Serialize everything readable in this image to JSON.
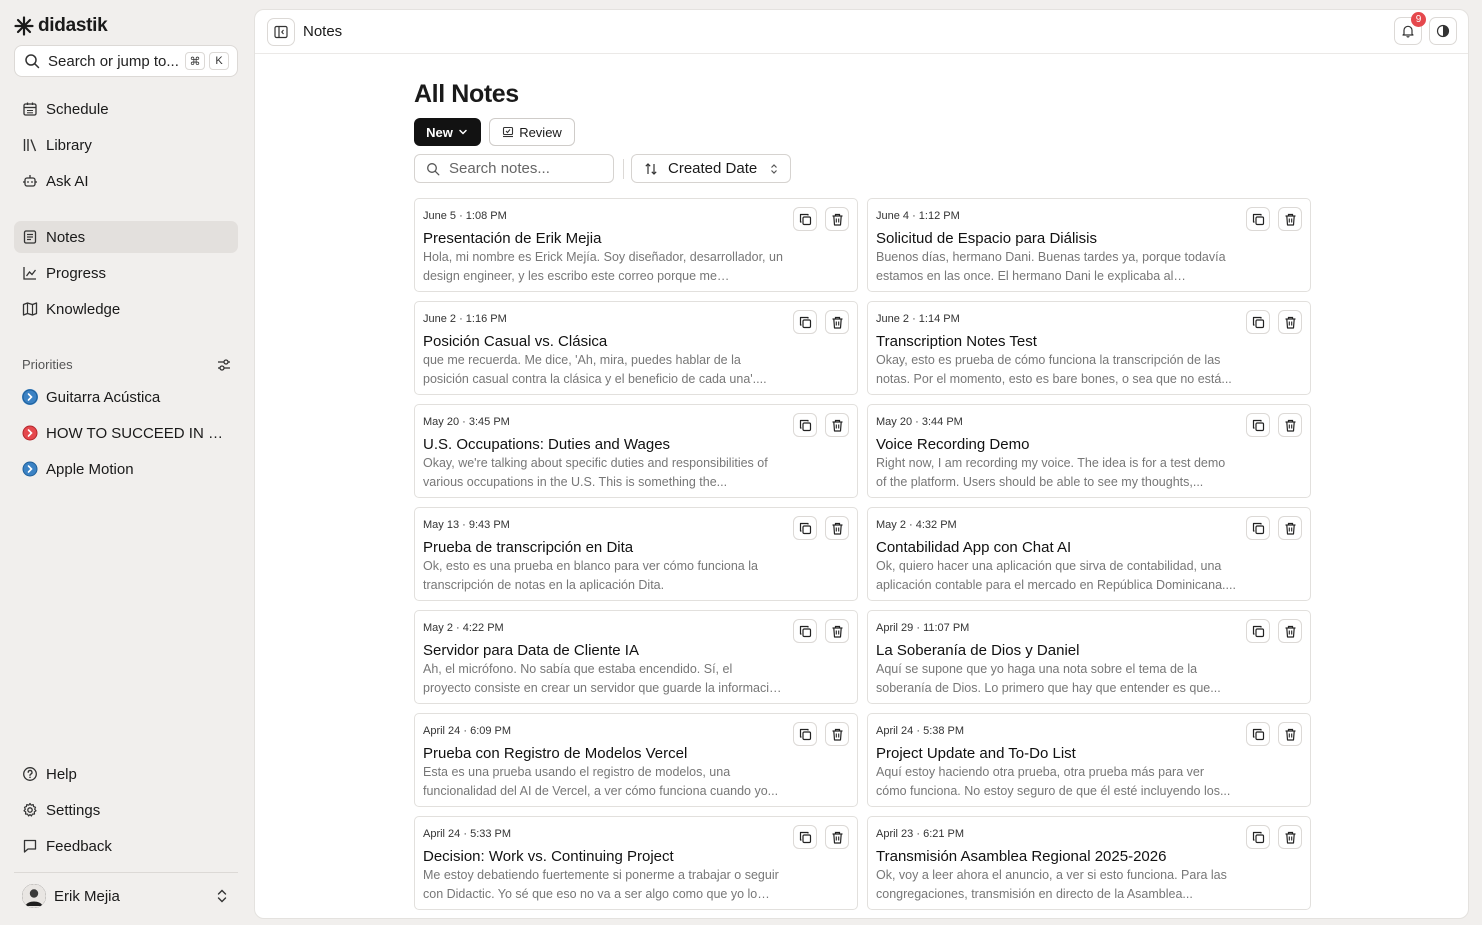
{
  "brand": {
    "name": "didastik"
  },
  "sidebar": {
    "search_placeholder": "Search or jump to...",
    "shortcut_keys": [
      "⌘",
      "K"
    ],
    "nav_top": [
      {
        "label": "Schedule",
        "icon": "calendar-icon"
      },
      {
        "label": "Library",
        "icon": "library-icon"
      },
      {
        "label": "Ask AI",
        "icon": "bot-icon"
      }
    ],
    "nav_main": [
      {
        "label": "Notes",
        "icon": "notes-icon",
        "active": true
      },
      {
        "label": "Progress",
        "icon": "chart-icon"
      },
      {
        "label": "Knowledge",
        "icon": "map-icon"
      }
    ],
    "priorities_label": "Priorities",
    "priorities": [
      {
        "label": "Guitarra Acústica",
        "color": "#3b82c4"
      },
      {
        "label": "HOW TO SUCCEED IN MRBEAST PRODUCTION",
        "color": "#e5484d"
      },
      {
        "label": "Apple Motion",
        "color": "#3b82c4"
      }
    ],
    "nav_bottom": [
      {
        "label": "Help",
        "icon": "help-icon"
      },
      {
        "label": "Settings",
        "icon": "gear-icon"
      },
      {
        "label": "Feedback",
        "icon": "feedback-icon"
      }
    ],
    "user": {
      "name": "Erik Mejia"
    }
  },
  "topbar": {
    "title": "Notes",
    "notification_count": "9"
  },
  "page": {
    "title": "All Notes",
    "new_label": "New",
    "review_label": "Review",
    "search_placeholder": "Search notes...",
    "sort_label": "Created Date"
  },
  "notes": [
    {
      "date": "June 5 · 1:08 PM",
      "title": "Presentación de Erik Mejia",
      "preview": "Hola, mi nombre es Erick Mejía. Soy diseñador, desarrollador, un design engineer, y les escribo este correo porque me interesaría..."
    },
    {
      "date": "June 4 · 1:12 PM",
      "title": "Solicitud de Espacio para Diálisis",
      "preview": "Buenos días, hermano Dani. Buenas tardes ya, porque todavía estamos en las once. El hermano Dani le explicaba al hermano..."
    },
    {
      "date": "June 2 · 1:16 PM",
      "title": "Posición Casual vs. Clásica",
      "preview": "que me recuerda. Me dice, 'Ah, mira, puedes hablar de la posición casual contra la clásica y el beneficio de cada una'...."
    },
    {
      "date": "June 2 · 1:14 PM",
      "title": "Transcription Notes Test",
      "preview": "Okay, esto es prueba de cómo funciona la transcripción de las notas. Por el momento, esto es bare bones, o sea que no está..."
    },
    {
      "date": "May 20 · 3:45 PM",
      "title": "U.S. Occupations: Duties and Wages",
      "preview": "Okay, we're talking about specific duties and responsibilities of various occupations in the U.S. This is something the..."
    },
    {
      "date": "May 20 · 3:44 PM",
      "title": "Voice Recording Demo",
      "preview": "Right now, I am recording my voice. The idea is for a test demo of the platform. Users should be able to see my thoughts,..."
    },
    {
      "date": "May 13 · 9:43 PM",
      "title": "Prueba de transcripción en Dita",
      "preview": "Ok, esto es una prueba en blanco para ver cómo funciona la transcripción de notas en la aplicación Dita."
    },
    {
      "date": "May 2 · 4:32 PM",
      "title": "Contabilidad App con Chat AI",
      "preview": "Ok, quiero hacer una aplicación que sirva de contabilidad, una aplicación contable para el mercado en República Dominicana...."
    },
    {
      "date": "May 2 · 4:22 PM",
      "title": "Servidor para Data de Cliente IA",
      "preview": "Ah, el micrófono. No sabía que estaba encendido. Sí, el proyecto consiste en crear un servidor que guarde la información del..."
    },
    {
      "date": "April 29 · 11:07 PM",
      "title": "La Soberanía de Dios y Daniel",
      "preview": "Aquí se supone que yo haga una nota sobre el tema de la soberanía de Dios. Lo primero que hay que entender es que..."
    },
    {
      "date": "April 24 · 6:09 PM",
      "title": "Prueba con Registro de Modelos Vercel",
      "preview": "Esta es una prueba usando el registro de modelos, una funcionalidad del AI de Vercel, a ver cómo funciona cuando yo..."
    },
    {
      "date": "April 24 · 5:38 PM",
      "title": "Project Update and To-Do List",
      "preview": "Aquí estoy haciendo otra prueba, otra prueba más para ver cómo funciona. No estoy seguro de que él esté incluyendo los..."
    },
    {
      "date": "April 24 · 5:33 PM",
      "title": "Decision: Work vs. Continuing Project",
      "preview": "Me estoy debatiendo fuertemente si ponerme a trabajar o seguir con Didactic. Yo sé que eso no va a ser algo como que yo lo voy..."
    },
    {
      "date": "April 23 · 6:21 PM",
      "title": "Transmisión Asamblea Regional 2025-2026",
      "preview": "Ok, voy a leer ahora el anuncio, a ver si esto funciona. Para las congregaciones, transmisión en directo de la Asamblea..."
    }
  ]
}
